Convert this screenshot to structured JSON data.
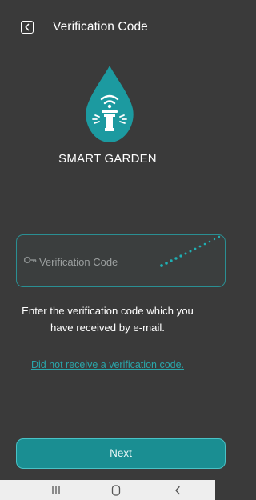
{
  "header": {
    "title": "Verification Code",
    "back_icon": "chevron-left-icon"
  },
  "brand": {
    "name": "SMART GARDEN",
    "logo_icon": "water-drop-sprinkler-icon",
    "accent": "#1c9aa0"
  },
  "form": {
    "placeholder": "Verification Code",
    "value": "",
    "icon": "key-icon"
  },
  "helper_text": "Enter the verification code which you have received by e-mail.",
  "resend_link": "Did not receive a verification code.",
  "next_button": "Next",
  "navbar": {
    "recent_icon": "recent-apps-icon",
    "home_icon": "home-icon",
    "back_icon": "back-icon"
  },
  "colors": {
    "background": "#3a3a3a",
    "accent": "#1a8e92",
    "border": "#2a8f93",
    "link": "#2aa6aa",
    "navbar": "#eeeeee"
  }
}
